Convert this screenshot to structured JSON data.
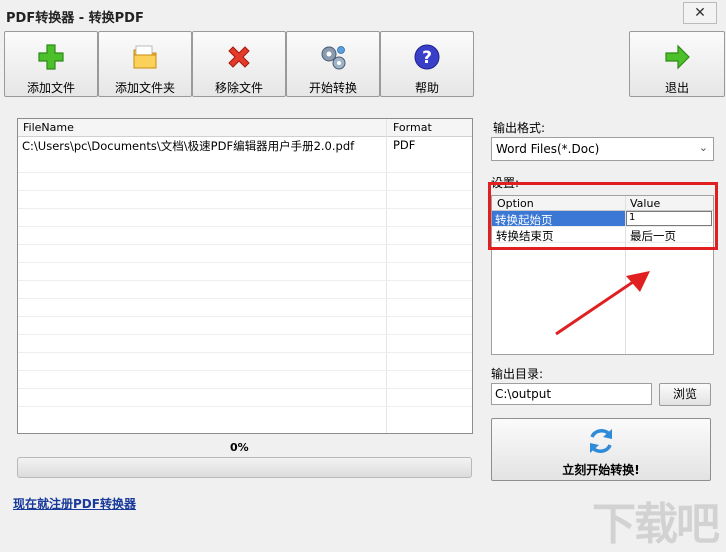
{
  "window": {
    "title": "PDF转换器 - 转换PDF",
    "close_glyph": "✕"
  },
  "toolbar": {
    "add_file": {
      "label": "添加文件",
      "icon": "add-plus-icon"
    },
    "add_folder": {
      "label": "添加文件夹",
      "icon": "folder-icon"
    },
    "remove_file": {
      "label": "移除文件",
      "icon": "remove-x-icon"
    },
    "start_convert": {
      "label": "开始转换",
      "icon": "gears-icon"
    },
    "help": {
      "label": "帮助",
      "icon": "help-question-icon"
    },
    "exit": {
      "label": "退出",
      "icon": "exit-arrow-icon"
    }
  },
  "file_list": {
    "columns": [
      "FileName",
      "Format"
    ],
    "rows": [
      {
        "filename": "C:\\Users\\pc\\Documents\\文档\\极速PDF编辑器用户手册2.0.pdf",
        "format": "PDF"
      }
    ]
  },
  "progress": {
    "text": "0%",
    "value": 0
  },
  "register_link": "现在就注册PDF转换器",
  "output_format": {
    "label": "输出格式:",
    "selected": "Word Files(*.Doc)"
  },
  "settings": {
    "label": "设置:",
    "columns": [
      "Option",
      "Value"
    ],
    "rows": [
      {
        "option": "转换起始页",
        "value": "1"
      },
      {
        "option": "转换结束页",
        "value": "最后一页"
      }
    ]
  },
  "output_dir": {
    "label": "输出目录:",
    "value": "C:\\output",
    "browse_label": "浏览"
  },
  "start_button": {
    "label": "立刻开始转换!"
  },
  "watermark": "下载吧",
  "colors": {
    "highlight": "#e02020",
    "selection": "#3b78d6",
    "link": "#1a3a9a"
  }
}
